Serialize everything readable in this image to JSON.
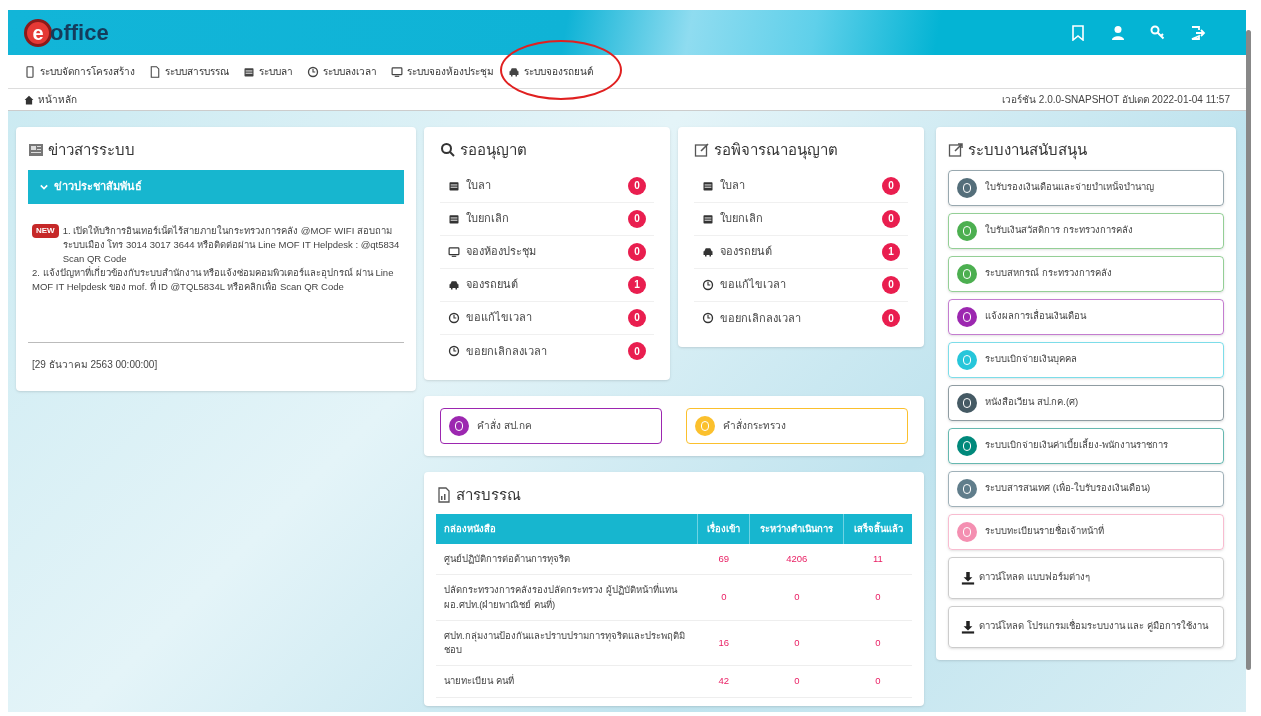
{
  "header": {
    "logo_letter": "e",
    "logo_text": "office"
  },
  "nav": [
    {
      "label": "ระบบจัดการโครงสร้าง"
    },
    {
      "label": "ระบบสารบรรณ"
    },
    {
      "label": "ระบบลา"
    },
    {
      "label": "ระบบลงเวลา"
    },
    {
      "label": "ระบบจองห้องประชุม"
    },
    {
      "label": "ระบบจองรถยนต์"
    }
  ],
  "breadcrumb": "หน้าหลัก",
  "version": "เวอร์ชัน 2.0.0-SNAPSHOT อัปเดต 2022-01-04 11:57",
  "news": {
    "title": "ข่าวสารระบบ",
    "section": "ข่าวประชาสัมพันธ์",
    "badge": "NEW",
    "items": [
      "1. เปิดให้บริการอินเทอร์เน็ตไร้สายภายในกระทรวงการคลัง @MOF WIFI สอบถามระบบเมือง โทร 3014 3017 3644 หรือติดต่อผ่าน Line MOF IT Helpdesk : @qt5834 Scan QR Code",
      "2. แจ้งปัญหาที่เกี่ยวข้องกับระบบสำนักงาน หรือแจ้งซ่อมคอมพิวเตอร์และอุปกรณ์ ผ่าน Line MOF IT Helpdesk ของ mof. ที่ ID @TQL5834L หรือคลิกเพื่อ Scan QR Code"
    ],
    "date": "[29 ธันวาคม 2563 00:00:00]"
  },
  "pending": {
    "title": "รออนุญาต",
    "items": [
      {
        "label": "ใบลา",
        "count": "0"
      },
      {
        "label": "ใบยกเลิก",
        "count": "0"
      },
      {
        "label": "จองห้องประชุม",
        "count": "0"
      },
      {
        "label": "จองรถยนต์",
        "count": "1"
      },
      {
        "label": "ขอแก้ไขเวลา",
        "count": "0"
      },
      {
        "label": "ขอยกเลิกลงเวลา",
        "count": "0"
      }
    ]
  },
  "review": {
    "title": "รอพิจารณาอนุญาต",
    "items": [
      {
        "label": "ใบลา",
        "count": "0"
      },
      {
        "label": "ใบยกเลิก",
        "count": "0"
      },
      {
        "label": "จองรถยนต์",
        "count": "1"
      },
      {
        "label": "ขอแก้ไขเวลา",
        "count": "0"
      },
      {
        "label": "ขอยกเลิกลงเวลา",
        "count": "0"
      }
    ]
  },
  "quick_links": [
    {
      "label": "คำสั่ง สป.กค",
      "color": "#9c27b0"
    },
    {
      "label": "คำสั่งกระทรวง",
      "color": "#fbc02d"
    }
  ],
  "saraban": {
    "title": "สารบรรณ",
    "columns": [
      "กล่องหนังสือ",
      "เรื่องเข้า",
      "ระหว่างดำเนินการ",
      "เสร็จสิ้นแล้ว"
    ],
    "rows": [
      [
        "ศูนย์ปฏิบัติการต่อต้านการทุจริต",
        "69",
        "4206",
        "11"
      ],
      [
        "ปลัดกระทรวงการคลังรองปลัดกระทรวง ผู้ปฏิบัติหน้าที่แทน ผอ.ศปท.(ฝ่ายพาณิชย์ คนที่)",
        "0",
        "0",
        "0"
      ],
      [
        "ศปท.กลุ่มงานป้องกันและปราบปรามการทุจริตและประพฤติมิชอบ",
        "16",
        "0",
        "0"
      ],
      [
        "นายทะเบียน คนที่",
        "42",
        "0",
        "0"
      ]
    ]
  },
  "support": {
    "title": "ระบบงานสนับสนุน",
    "items": [
      {
        "kind": "system",
        "label": "ใบรับรองเงินเดือนและจ่ายบำเหน็จบำนาญ",
        "color": "#546e7a"
      },
      {
        "kind": "system",
        "label": "ใบรับเงินสวัสดิการ กระทรวงการคลัง",
        "color": "#4caf50"
      },
      {
        "kind": "system",
        "label": "ระบบสหกรณ์ กระทรวงการคลัง",
        "color": "#4caf50"
      },
      {
        "kind": "system",
        "label": "แจ้งผลการเลื่อนเงินเดือน",
        "color": "#9c27b0"
      },
      {
        "kind": "system",
        "label": "ระบบเบิกจ่ายเงินบุคคล",
        "color": "#26c6da"
      },
      {
        "kind": "system",
        "label": "หนังสือเวียน สป.กค.(ศ)",
        "color": "#455a64"
      },
      {
        "kind": "system",
        "label": "ระบบเบิกจ่ายเงินค่าเบี้ยเลี้ยง-พนักงานราชการ",
        "color": "#00897b"
      },
      {
        "kind": "system",
        "label": "ระบบสารสนเทศ (เพื่อ-ใบรับรองเงินเดือน)",
        "color": "#607d8b"
      },
      {
        "kind": "system",
        "label": "ระบบทะเบียนรายชื่อเจ้าหน้าที่",
        "color": "#f48fb1"
      },
      {
        "kind": "download",
        "label": "ดาวน์โหลด แบบฟอร์มต่างๆ"
      },
      {
        "kind": "download",
        "label": "ดาวน์โหลด โปรแกรมเชื่อมระบบงาน และ คู่มือการใช้งาน"
      }
    ]
  }
}
